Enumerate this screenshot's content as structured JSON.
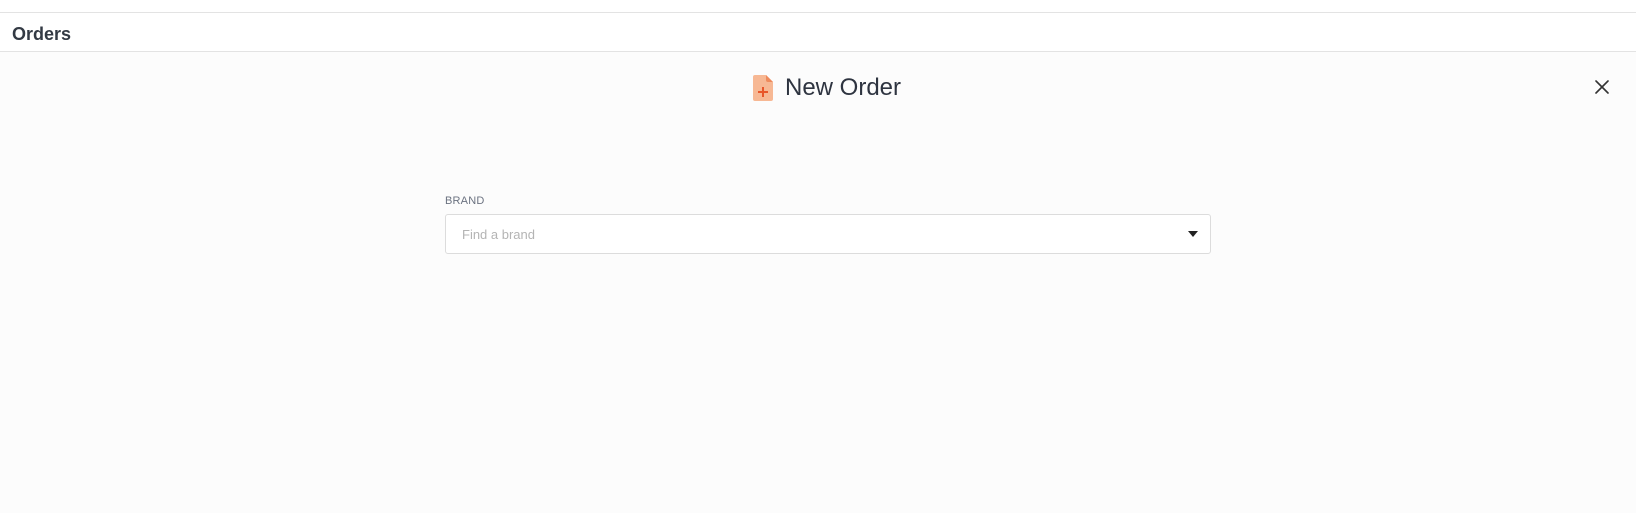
{
  "header": {
    "title": "Orders"
  },
  "modal": {
    "title": "New Order",
    "icon": "new-document-icon",
    "accent_color": "#f4a37c",
    "accent_dark": "#e8774a",
    "close_icon": "close-icon"
  },
  "form": {
    "brand": {
      "label": "BRAND",
      "placeholder": "Find a brand",
      "value": ""
    }
  }
}
